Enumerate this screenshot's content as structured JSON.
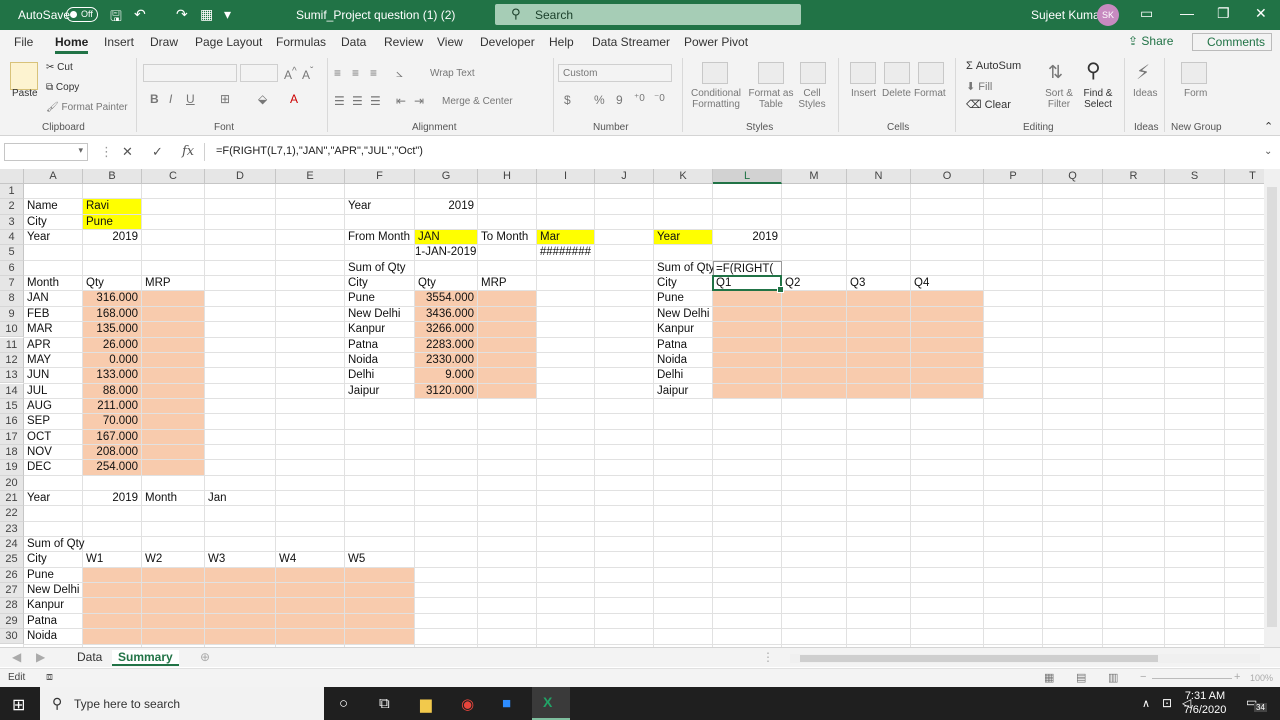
{
  "titlebar": {
    "autosave_label": "AutoSave",
    "autosave_state": "Off",
    "document_title": "Sumif_Project question (1) (2)",
    "search_placeholder": "Search",
    "user_name": "Sujeet Kumar",
    "user_initials": "SK",
    "accent_color": "#217346"
  },
  "ribbon_tabs": [
    "File",
    "Home",
    "Insert",
    "Draw",
    "Page Layout",
    "Formulas",
    "Data",
    "Review",
    "View",
    "Developer",
    "Help",
    "Data Streamer",
    "Power Pivot"
  ],
  "active_tab": "Home",
  "share_label": "Share",
  "comments_label": "Comments",
  "ribbon": {
    "clipboard": {
      "paste": "Paste",
      "cut": "Cut",
      "copy": "Copy",
      "format_painter": "Format Painter",
      "group": "Clipboard"
    },
    "font": {
      "group": "Font"
    },
    "alignment": {
      "wrap_text": "Wrap Text",
      "merge_center": "Merge & Center",
      "group": "Alignment"
    },
    "number": {
      "format_value": "Custom",
      "group": "Number"
    },
    "styles": {
      "conditional": "Conditional Formatting",
      "format_table": "Format as Table",
      "cell_styles": "Cell Styles",
      "group": "Styles"
    },
    "cells": {
      "insert": "Insert",
      "delete": "Delete",
      "format": "Format",
      "group": "Cells"
    },
    "editing": {
      "autosum": "AutoSum",
      "fill": "Fill",
      "clear": "Clear",
      "sort_filter": "Sort & Filter",
      "find_select": "Find & Select",
      "group": "Editing"
    },
    "ideas": {
      "ideas": "Ideas",
      "group": "Ideas"
    },
    "newgroup": {
      "form": "Form",
      "group": "New Group"
    }
  },
  "formula_bar": {
    "name_box": "",
    "formula": "=F(RIGHT(L7,1),\"JAN\",\"APR\",\"JUL\",\"Oct\")"
  },
  "columns": [
    "A",
    "B",
    "C",
    "D",
    "E",
    "F",
    "G",
    "H",
    "I",
    "J",
    "K",
    "L",
    "M",
    "N",
    "O",
    "P",
    "Q",
    "R",
    "S",
    "T"
  ],
  "selected_column": "L",
  "rows": [
    1,
    2,
    3,
    4,
    5,
    6,
    7,
    8,
    9,
    10,
    11,
    12,
    13,
    14,
    15,
    16,
    17,
    18,
    19,
    20,
    21,
    22,
    23,
    24,
    25,
    26,
    27,
    28,
    29,
    30
  ],
  "cells": {
    "A2": "Name",
    "B2": "Ravi",
    "A3": "City",
    "B3": "Pune",
    "A4": "Year",
    "B4": "2019",
    "A7": "Month",
    "B7": "Qty",
    "C7": "MRP",
    "A8": "JAN",
    "B8": "316.000",
    "A9": "FEB",
    "B9": "168.000",
    "A10": "MAR",
    "B10": "135.000",
    "A11": "APR",
    "B11": "26.000",
    "A12": "MAY",
    "B12": "0.000",
    "A13": "JUN",
    "B13": "133.000",
    "A14": "JUL",
    "B14": "88.000",
    "A15": "AUG",
    "B15": "211.000",
    "A16": "SEP",
    "B16": "70.000",
    "A17": "OCT",
    "B17": "167.000",
    "A18": "NOV",
    "B18": "208.000",
    "A19": "DEC",
    "B19": "254.000",
    "A21": "Year",
    "B21": "2019",
    "C21": "Month",
    "D21": "Jan",
    "A24": "Sum of Qty",
    "A25": "City",
    "B25": "W1",
    "C25": "W2",
    "D25": "W3",
    "E25": "W4",
    "F25": "W5",
    "A26": "Pune",
    "A27": "New Delhi",
    "A28": "Kanpur",
    "A29": "Patna",
    "A30": "Noida",
    "F2": "Year",
    "G2": "2019",
    "F4": "From Month",
    "G4": "JAN",
    "H4": "To Month",
    "I4": "Mar",
    "G5": "1-JAN-2019",
    "I5": "########",
    "F6": "Sum of Qty",
    "F7": "City",
    "G7": "Qty",
    "H7": "MRP",
    "F8": "Pune",
    "G8": "3554.000",
    "F9": "New Delhi",
    "G9": "3436.000",
    "F10": "Kanpur",
    "G10": "3266.000",
    "F11": "Patna",
    "G11": "2283.000",
    "F12": "Noida",
    "G12": "2330.000",
    "F13": "Delhi",
    "G13": "9.000",
    "F14": "Jaipur",
    "G14": "3120.000",
    "K4": "Year",
    "L4": "2019",
    "K6": "Sum of Qty",
    "L6": "=F(RIGHT(",
    "K7": "City",
    "L7": "Q1",
    "M7": "Q2",
    "N7": "Q3",
    "O7": "Q4",
    "K8": "Pune",
    "K9": "New Delhi",
    "K10": "Kanpur",
    "K11": "Patna",
    "K12": "Noida",
    "K13": "Delhi",
    "K14": "Jaipur"
  },
  "fill_colors": {
    "yellow": "#ffff00",
    "peach": "#f8cbad"
  },
  "sheets": [
    "Data",
    "Summary"
  ],
  "active_sheet": "Summary",
  "status": {
    "mode": "Edit",
    "zoom": "100%"
  },
  "taskbar": {
    "search_placeholder": "Type here to search",
    "time": "7:31 AM",
    "date": "7/6/2020",
    "notification_count": "34"
  }
}
